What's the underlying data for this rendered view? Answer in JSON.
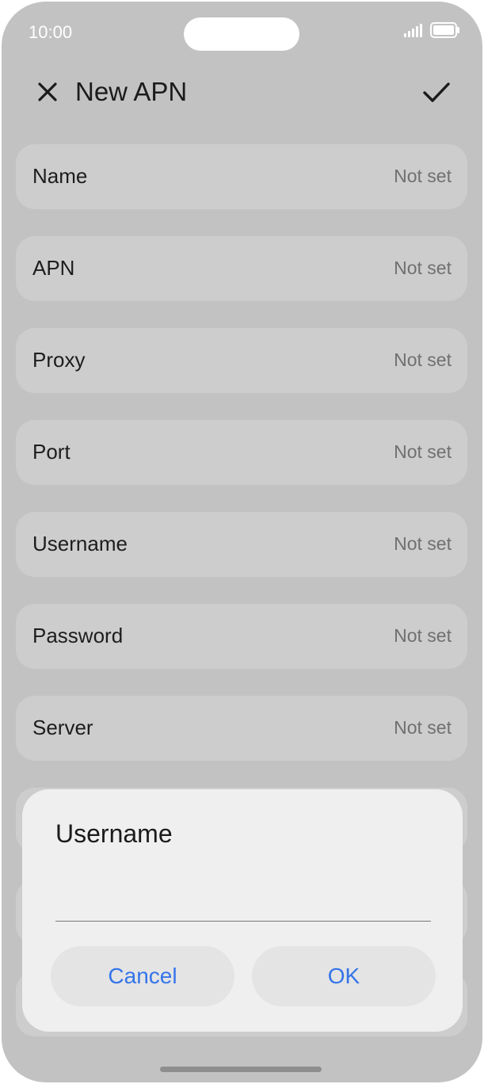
{
  "status_bar": {
    "time": "10:00",
    "icons": [
      "signal-icon",
      "battery-icon"
    ]
  },
  "header": {
    "title": "New APN",
    "close_icon": "close-icon",
    "confirm_icon": "checkmark-icon"
  },
  "rows": [
    {
      "label": "Name",
      "value": "Not set"
    },
    {
      "label": "APN",
      "value": "Not set"
    },
    {
      "label": "Proxy",
      "value": "Not set"
    },
    {
      "label": "Port",
      "value": "Not set"
    },
    {
      "label": "Username",
      "value": "Not set"
    },
    {
      "label": "Password",
      "value": "Not set"
    },
    {
      "label": "Server",
      "value": "Not set"
    }
  ],
  "dialog": {
    "title": "Username",
    "input_value": "",
    "cancel_label": "Cancel",
    "ok_label": "OK"
  },
  "colors": {
    "accent": "#3574e8",
    "background": "#c2c2c3",
    "dialog": "#efefef"
  }
}
